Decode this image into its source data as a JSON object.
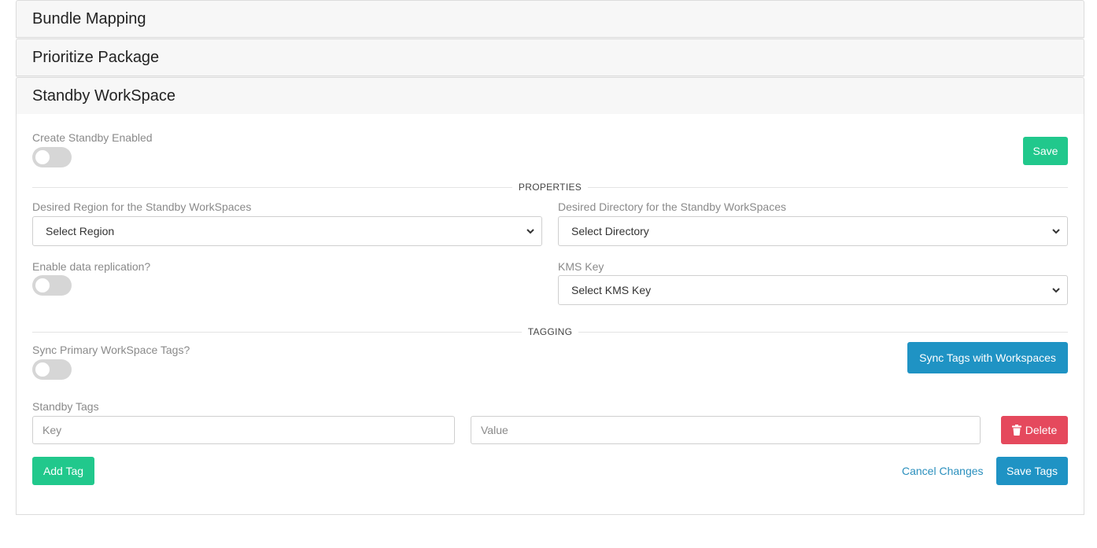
{
  "accordion": {
    "sections": [
      {
        "title": "Bundle Mapping"
      },
      {
        "title": "Prioritize Package"
      },
      {
        "title": "Standby WorkSpace"
      }
    ]
  },
  "standby": {
    "create_enabled_label": "Create Standby Enabled",
    "create_enabled_value": false,
    "save_label": "Save",
    "properties_title": "PROPERTIES",
    "region_label": "Desired Region for the Standby WorkSpaces",
    "region_selected": "Select Region",
    "directory_label": "Desired Directory for the Standby WorkSpaces",
    "directory_selected": "Select Directory",
    "replication_label": "Enable data replication?",
    "replication_value": false,
    "kms_label": "KMS Key",
    "kms_selected": "Select KMS Key",
    "tagging_title": "TAGGING",
    "sync_tags_label": "Sync Primary WorkSpace Tags?",
    "sync_tags_value": false,
    "sync_button_label": "Sync Tags with Workspaces",
    "standby_tags_label": "Standby Tags",
    "tag_rows": [
      {
        "key_placeholder": "Key",
        "value_placeholder": "Value",
        "delete_label": "Delete"
      }
    ],
    "add_tag_label": "Add Tag",
    "cancel_label": "Cancel Changes",
    "save_tags_label": "Save Tags"
  },
  "colors": {
    "green": "#21c88c",
    "blue": "#1f93c4",
    "red": "#e5495d",
    "link": "#2a8fbd"
  },
  "icons": {
    "trash": "trash-icon",
    "chevron": "chevron-down-icon"
  }
}
